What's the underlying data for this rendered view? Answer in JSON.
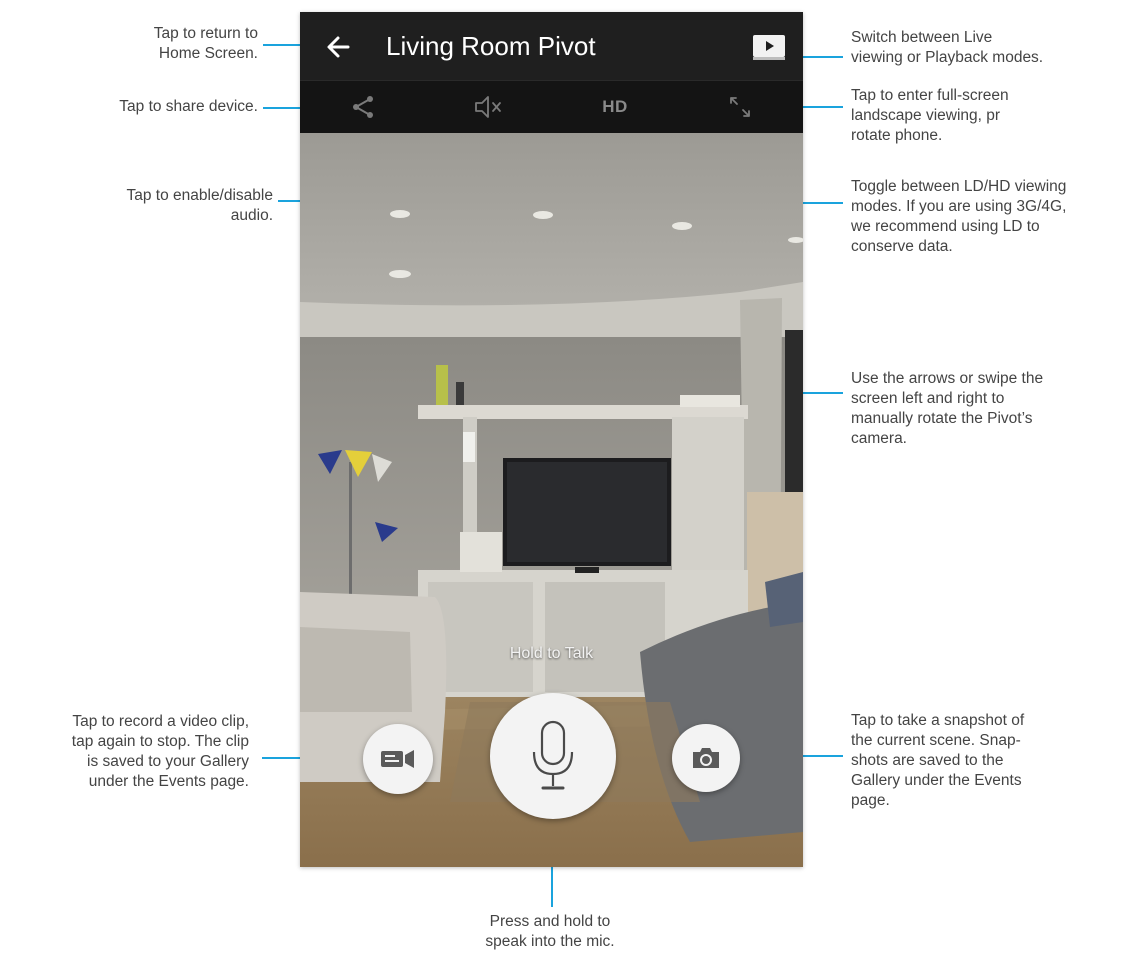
{
  "app": {
    "title": "Living Room Pivot",
    "toolbar": {
      "hd_label": "HD"
    },
    "hold_to_talk": "Hold to Talk"
  },
  "annotations": {
    "back": "Tap to return to\nHome Screen.",
    "share": "Tap to share device.",
    "audio": "Tap to enable/disable\naudio.",
    "record": "Tap to record a video clip,\ntap again to stop. The clip\nis saved to your Gallery\nunder the Events page.",
    "mode": "Switch between Live\nviewing or Playback modes.",
    "fullscreen": "Tap to enter full-screen\nlandscape viewing, pr\nrotate phone.",
    "hd": "Toggle between LD/HD viewing\nmodes. If you are using 3G/4G,\nwe recommend using LD to\nconserve data.",
    "rotate": "Use the arrows or swipe the\nscreen left and right to\nmanually rotate the Pivot’s\ncamera.",
    "snapshot": "Tap to take a snapshot of\nthe current scene. Snap-\nshots are saved to the\nGallery under the Events\npage.",
    "mic": "Press and hold to\nspeak into the mic."
  },
  "colors": {
    "accent": "#1aa3dd",
    "topbar": "#1f1f1f",
    "toolbar": "#141414",
    "button_bg": "#f3f3f3"
  },
  "icons": [
    "back-arrow-icon",
    "live-playback-icon",
    "share-icon",
    "speaker-muted-icon",
    "fullscreen-icon",
    "video-record-icon",
    "microphone-icon",
    "camera-icon"
  ]
}
